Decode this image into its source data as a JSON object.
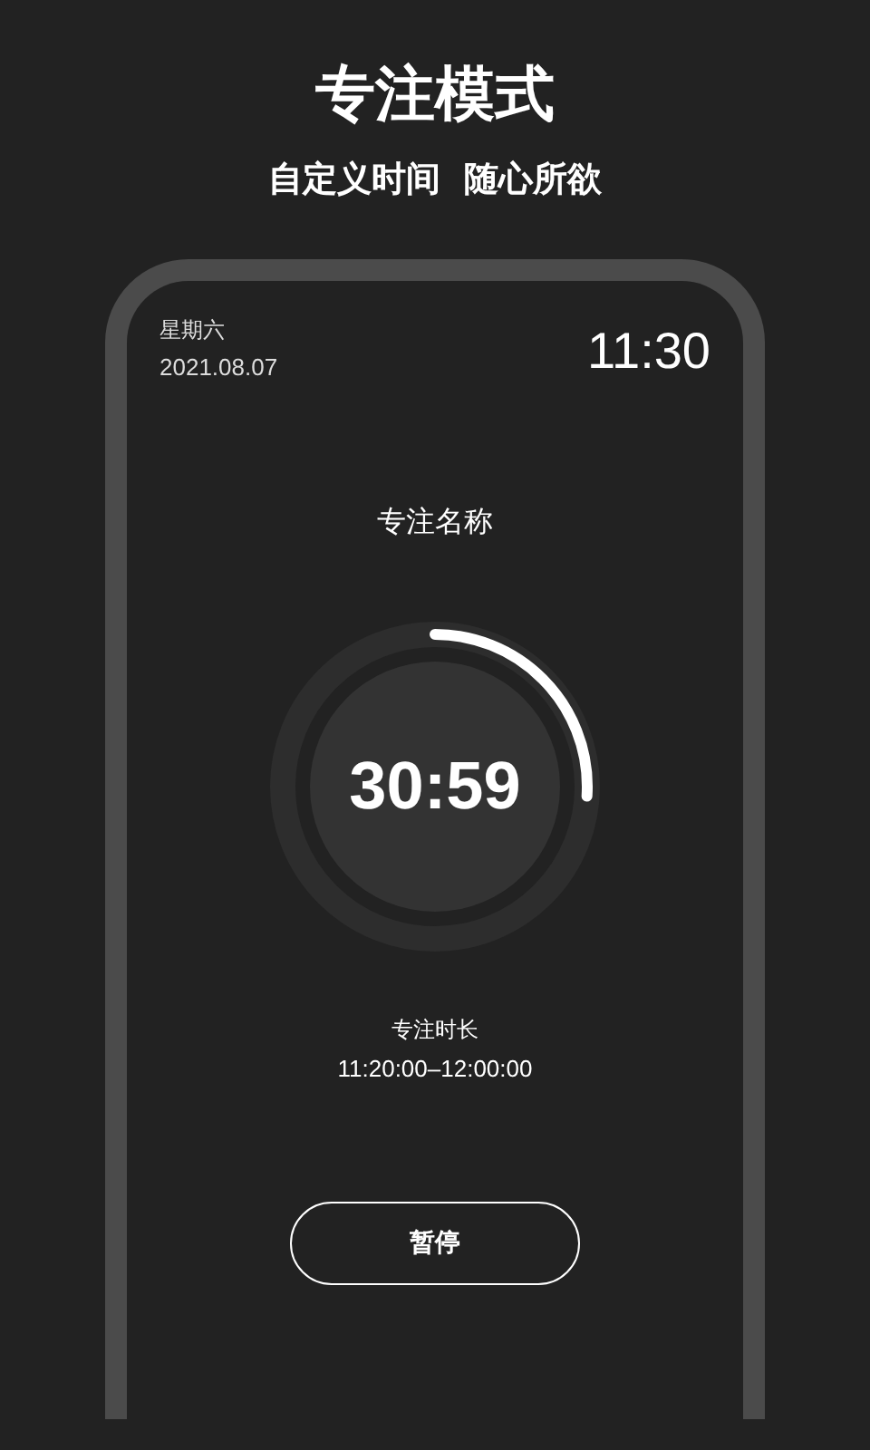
{
  "headline": "专注模式",
  "subheadline": "自定义时间  随心所欲",
  "phone": {
    "weekday": "星期六",
    "date": "2021.08.07",
    "clock": "11:30",
    "focus_name": "专注名称",
    "timer": {
      "remaining": "30:59",
      "level": 0.26
    },
    "duration_label": "专注时长",
    "duration_range": "11:20:00–12:00:00",
    "pause_button": "暂停"
  }
}
